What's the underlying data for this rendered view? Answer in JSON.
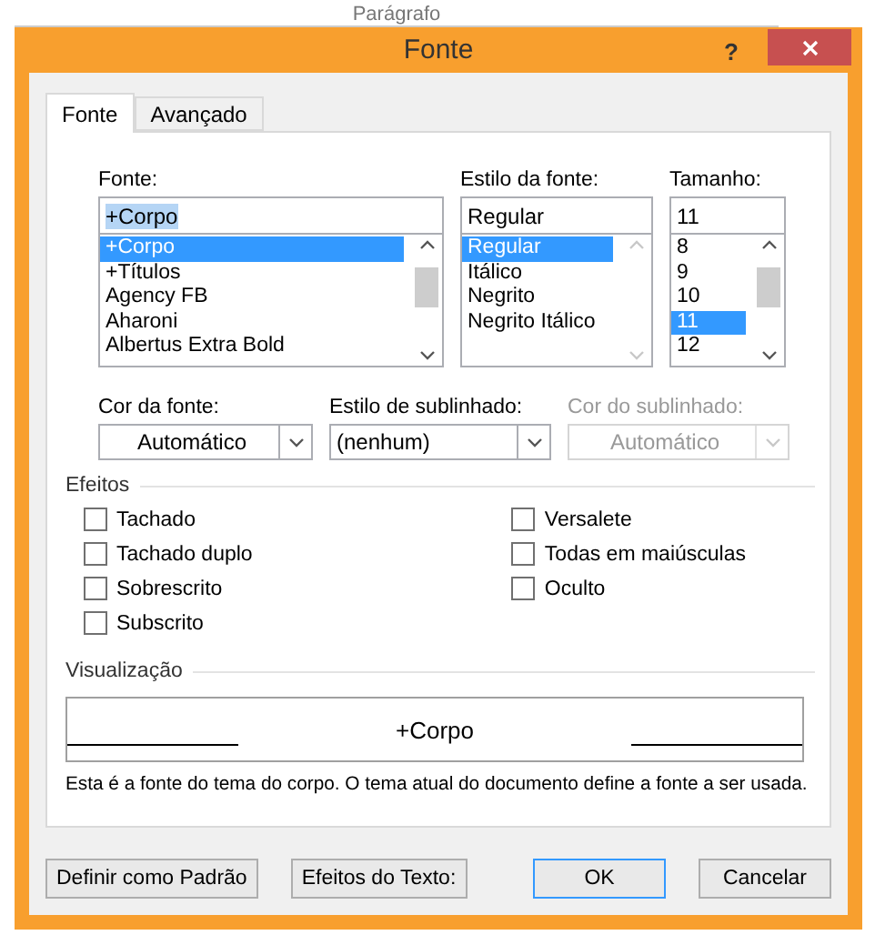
{
  "background": {
    "ribbon_label": "Parágrafo"
  },
  "window": {
    "title": "Fonte",
    "help": "?"
  },
  "tabs": [
    {
      "label": "Fonte",
      "selected": true
    },
    {
      "label": "Avançado",
      "selected": false
    }
  ],
  "font_lists": [
    {
      "label": "Fonte:",
      "value": "+Corpo",
      "value_highlighted": true,
      "scrollbar_enabled": true,
      "items": [
        {
          "label": "+Corpo",
          "selected": true
        },
        {
          "label": "+Títulos",
          "selected": false
        },
        {
          "label": "Agency FB",
          "selected": false
        },
        {
          "label": "Aharoni",
          "selected": false
        },
        {
          "label": "Albertus Extra Bold",
          "selected": false
        }
      ]
    },
    {
      "label": "Estilo da fonte:",
      "value": "Regular",
      "value_highlighted": false,
      "scrollbar_enabled": false,
      "items": [
        {
          "label": "Regular",
          "selected": true
        },
        {
          "label": "Itálico",
          "selected": false
        },
        {
          "label": "Negrito",
          "selected": false
        },
        {
          "label": "Negrito Itálico",
          "selected": false
        }
      ]
    },
    {
      "label": "Tamanho:",
      "value": "11",
      "value_highlighted": false,
      "scrollbar_enabled": true,
      "items": [
        {
          "label": "8",
          "selected": false
        },
        {
          "label": "9",
          "selected": false
        },
        {
          "label": "10",
          "selected": false
        },
        {
          "label": "11",
          "selected": true
        },
        {
          "label": "12",
          "selected": false
        }
      ]
    }
  ],
  "dropdowns": [
    {
      "label": "Cor da fonte:",
      "value": "Automático",
      "kind": "color",
      "disabled": false
    },
    {
      "label": "Estilo de sublinhado:",
      "value": "(nenhum)",
      "kind": "style",
      "disabled": false
    },
    {
      "label": "Cor do sublinhado:",
      "value": "Automático",
      "kind": "color",
      "disabled": true
    }
  ],
  "effects": {
    "title": "Efeitos",
    "left": [
      {
        "label": "Tachado",
        "checked": false
      },
      {
        "label": "Tachado duplo",
        "checked": false
      },
      {
        "label": "Sobrescrito",
        "checked": false
      },
      {
        "label": "Subscrito",
        "checked": false
      }
    ],
    "right": [
      {
        "label": "Versalete",
        "checked": false
      },
      {
        "label": "Todas em maiúsculas",
        "checked": false
      },
      {
        "label": "Oculto",
        "checked": false
      }
    ]
  },
  "preview": {
    "title": "Visualização",
    "sample": "+Corpo",
    "description": "Esta é a fonte do tema do corpo. O tema atual do documento define a fonte a ser usada."
  },
  "buttons": [
    {
      "label": "Definir como Padrão",
      "kind": "left",
      "default": false
    },
    {
      "label": "Efeitos do Texto:",
      "kind": "left",
      "default": false
    },
    {
      "label": "OK",
      "kind": "right",
      "default": true
    },
    {
      "label": "Cancelar",
      "kind": "right",
      "default": false
    }
  ]
}
